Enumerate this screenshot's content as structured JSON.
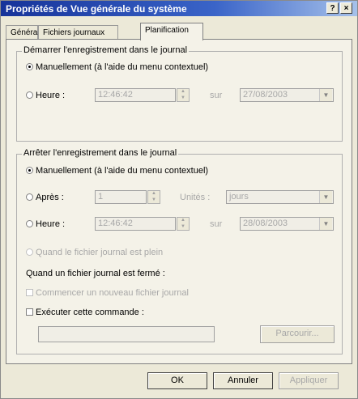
{
  "window": {
    "title": "Propriétés de Vue générale du système",
    "help": "?",
    "close": "×"
  },
  "tabs": [
    {
      "label": "Général"
    },
    {
      "label": "Fichiers journaux"
    },
    {
      "label": "Planification"
    }
  ],
  "start_group": {
    "legend": "Démarrer l'enregistrement dans le journal",
    "manual": "Manuellement (à l'aide du menu contextuel)",
    "time_label": "Heure :",
    "time_value": "12:46:42",
    "on_label": "sur",
    "date_value": "27/08/2003"
  },
  "stop_group": {
    "legend": "Arrêter l'enregistrement dans le journal",
    "manual": "Manuellement (à l'aide du menu contextuel)",
    "after_label": "Après :",
    "after_value": "1",
    "units_label": "Unités :",
    "units_value": "jours",
    "time_label": "Heure :",
    "time_value": "12:46:42",
    "on_label": "sur",
    "date_value": "28/08/2003",
    "when_full": "Quand le fichier journal est plein",
    "when_closed": "Quand un fichier journal est fermé :",
    "start_new": "Commencer un nouveau fichier journal",
    "run_command": "Exécuter cette commande :",
    "command_value": "",
    "browse": "Parcourir..."
  },
  "footer": {
    "ok": "OK",
    "cancel": "Annuler",
    "apply": "Appliquer"
  }
}
